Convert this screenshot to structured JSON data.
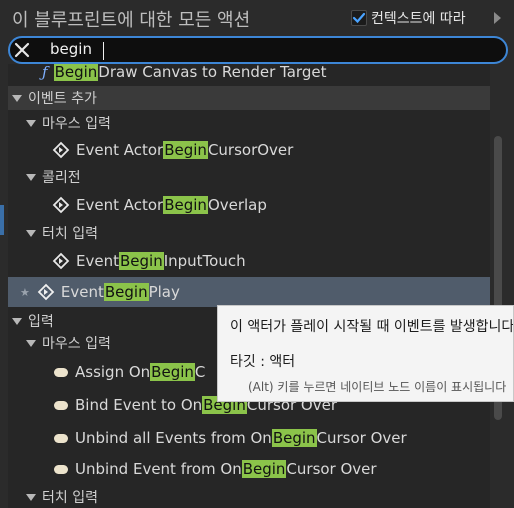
{
  "header": {
    "title": "이 블루프린트에 대한 모든 액션",
    "context_label": "컨텍스트에 따라",
    "context_checked": true
  },
  "search": {
    "value": "begin"
  },
  "rows": [
    {
      "kind": "func",
      "pre": "",
      "hl": "Begin",
      "post": " Draw Canvas to Render Target"
    },
    {
      "kind": "cat",
      "label": "이벤트 추가"
    },
    {
      "kind": "sub",
      "label": "마우스 입력"
    },
    {
      "kind": "event",
      "pre": "Event Actor",
      "hl": "Begin",
      "post": "CursorOver"
    },
    {
      "kind": "sub",
      "label": "콜리전"
    },
    {
      "kind": "event",
      "pre": "Event Actor",
      "hl": "Begin",
      "post": "Overlap"
    },
    {
      "kind": "sub",
      "label": "터치 입력"
    },
    {
      "kind": "event",
      "pre": "Event ",
      "hl": "Begin",
      "post": "InputTouch"
    },
    {
      "kind": "event-selected",
      "pre": "Event ",
      "hl": "Begin",
      "post": "Play"
    },
    {
      "kind": "cat",
      "label": "입력"
    },
    {
      "kind": "sub",
      "label": "마우스 입력"
    },
    {
      "kind": "bind",
      "pre": "Assign On ",
      "hl": "Begin",
      "post": " C"
    },
    {
      "kind": "bind",
      "pre": "Bind Event to On ",
      "hl": "Begin",
      "post": " Cursor Over"
    },
    {
      "kind": "bind",
      "pre": "Unbind all Events from On ",
      "hl": "Begin",
      "post": " Cursor Over"
    },
    {
      "kind": "bind",
      "pre": "Unbind Event from On ",
      "hl": "Begin",
      "post": " Cursor Over"
    },
    {
      "kind": "sub",
      "label": "터치 입력"
    }
  ],
  "tooltip": {
    "description": "이 액터가 플레이 시작될 때 이벤트를 발생합니다",
    "target": "타깃 : 액터",
    "hint": "(Alt) 키를 누르면 네이티브 노드 이름이 표시됩니다"
  },
  "colors": {
    "highlight": "#8bc34a",
    "search_border": "#3d86d6",
    "selected_row": "#505c6b",
    "checkbox_check": "#4aa3ff"
  }
}
